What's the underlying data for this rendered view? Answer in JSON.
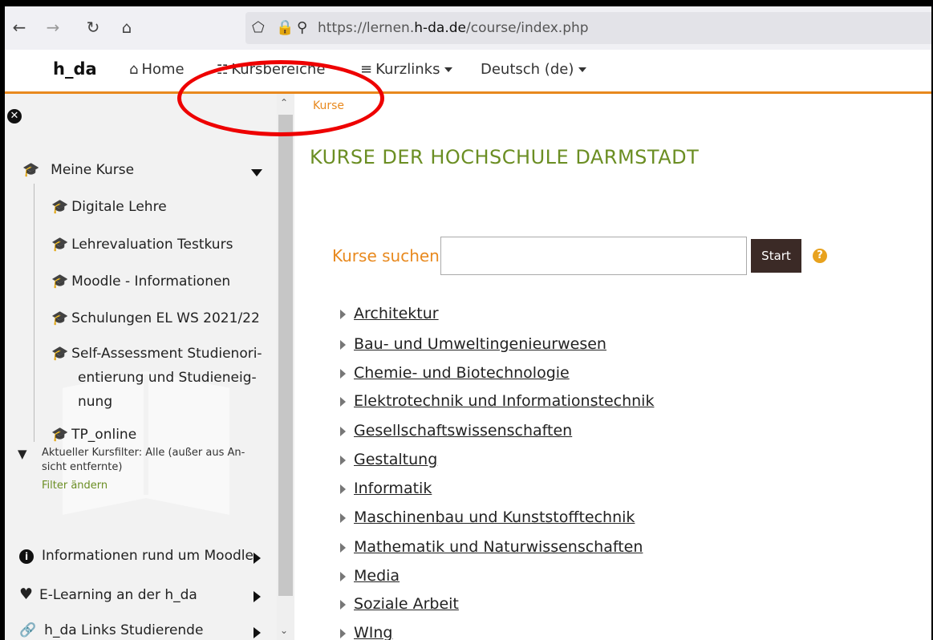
{
  "browser": {
    "url_prefix": "https://lernen.",
    "url_domain": "h-da.de",
    "url_path": "/course/index.php",
    "icons": [
      "back-icon",
      "forward-icon",
      "reload-icon",
      "home-icon",
      "shield-icon",
      "lock-icon",
      "key-icon"
    ]
  },
  "navbar": {
    "brand": "h_da",
    "home": "Home",
    "kursbereiche": "Kursbereiche",
    "kurzlinks": "Kurzlinks",
    "language": "Deutsch (de)",
    "accent_color": "#e8891e"
  },
  "annotation": {
    "color": "#e00000",
    "shape": "ellipse"
  },
  "drawer": {
    "meine_kurse": "Meine Kurse",
    "courses": [
      "Digitale Lehre",
      "Lehrevaluation Testkurs",
      "Moodle - Informationen",
      "Schulungen EL WS 2021/22",
      "Self-Assessment Studienori-",
      "entierung und Studieneig-",
      "nung",
      "TP_online"
    ],
    "filter_line1": "Aktueller Kursfilter: Alle (außer aus An-",
    "filter_line2": "sicht entfernte)",
    "filter_link": "Filter ändern",
    "sections": [
      {
        "label": "Informationen rund um Moodle",
        "icon": "info-icon"
      },
      {
        "label": "E-Learning an der h_da",
        "icon": "heart-icon"
      },
      {
        "label": "h_da Links Studierende",
        "icon": "link-icon"
      }
    ]
  },
  "main": {
    "breadcrumb": "Kurse",
    "title": "KURSE DER HOCHSCHULE DARMSTADT",
    "search_label": "Kurse suchen",
    "search_value": "",
    "start_button": "Start",
    "title_color": "#6b8e23",
    "categories": [
      "Architektur",
      "Bau- und Umweltingenieurwesen",
      "Chemie- und Biotechnologie",
      "Elektrotechnik und Informationstechnik",
      "Gesellschaftswissenschaften",
      "Gestaltung",
      "Informatik",
      "Maschinenbau und Kunststofftechnik",
      "Mathematik und Naturwissenschaften",
      "Media",
      "Soziale Arbeit",
      "WIng"
    ]
  }
}
